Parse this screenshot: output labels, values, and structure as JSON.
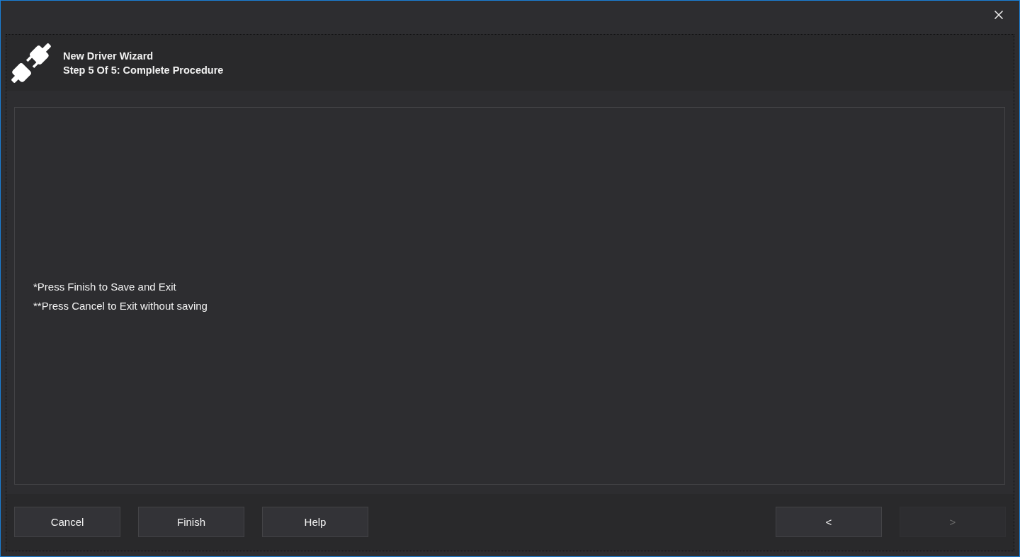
{
  "header": {
    "title": "New Driver Wizard",
    "subtitle": "Step 5 Of 5: Complete Procedure"
  },
  "notes": [
    "*Press Finish to Save and Exit",
    "**Press Cancel to Exit without saving"
  ],
  "footer": {
    "left_buttons": [
      {
        "label": "Cancel",
        "disabled": false
      },
      {
        "label": "Finish",
        "disabled": false
      },
      {
        "label": "Help",
        "disabled": false
      }
    ],
    "right_buttons": [
      {
        "label": "<",
        "disabled": false
      },
      {
        "label": ">",
        "disabled": true
      }
    ]
  }
}
